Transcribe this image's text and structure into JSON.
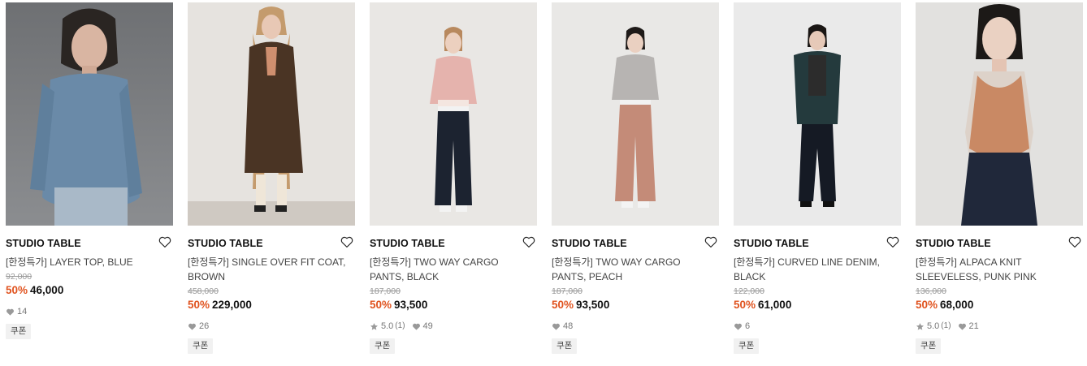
{
  "products": [
    {
      "brand": "STUDIO TABLE",
      "name": "[한정특가] LAYER TOP, BLUE",
      "original_price": "92,000",
      "discount": "50%",
      "price": "46,000",
      "rating": "",
      "rating_count": "",
      "likes": "14",
      "coupon": "쿠폰"
    },
    {
      "brand": "STUDIO TABLE",
      "name": "[한정특가] SINGLE OVER FIT COAT, BROWN",
      "original_price": "458,000",
      "discount": "50%",
      "price": "229,000",
      "rating": "",
      "rating_count": "",
      "likes": "26",
      "coupon": "쿠폰"
    },
    {
      "brand": "STUDIO TABLE",
      "name": "[한정특가] TWO WAY CARGO PANTS, BLACK",
      "original_price": "187,000",
      "discount": "50%",
      "price": "93,500",
      "rating": "5.0",
      "rating_count": "(1)",
      "likes": "49",
      "coupon": "쿠폰"
    },
    {
      "brand": "STUDIO TABLE",
      "name": "[한정특가] TWO WAY CARGO PANTS, PEACH",
      "original_price": "187,000",
      "discount": "50%",
      "price": "93,500",
      "rating": "",
      "rating_count": "",
      "likes": "48",
      "coupon": "쿠폰"
    },
    {
      "brand": "STUDIO TABLE",
      "name": "[한정특가] CURVED LINE DENIM, BLACK",
      "original_price": "122,000",
      "discount": "50%",
      "price": "61,000",
      "rating": "",
      "rating_count": "",
      "likes": "6",
      "coupon": "쿠폰"
    },
    {
      "brand": "STUDIO TABLE",
      "name": "[한정특가] ALPACA KNIT SLEEVELESS, PUNK PINK",
      "original_price": "136,000",
      "discount": "50%",
      "price": "68,000",
      "rating": "5.0",
      "rating_count": "(1)",
      "likes": "21",
      "coupon": "쿠폰"
    }
  ],
  "colors": {
    "discount": "#e0531f",
    "brand_text": "#111111",
    "meta_text": "#777777",
    "coupon_bg": "#f1f1f1"
  },
  "icons": {
    "wishlist": "heart-outline-icon",
    "likes": "heart-filled-icon",
    "rating": "star-icon"
  }
}
